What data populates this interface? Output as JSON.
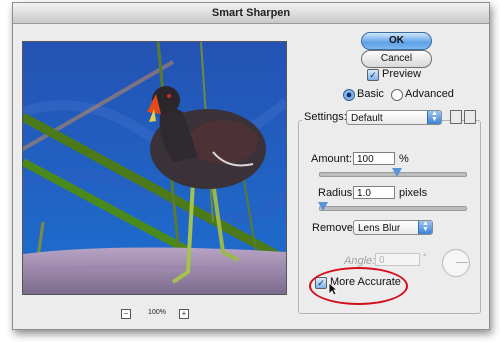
{
  "window": {
    "title": "Smart Sharpen"
  },
  "preview": {
    "zoom_label": "100%",
    "zoom_out": "−",
    "zoom_in": "+"
  },
  "buttons": {
    "ok": "OK",
    "cancel": "Cancel"
  },
  "preview_toggle": {
    "label": "Preview",
    "checked": true
  },
  "mode": {
    "basic_label": "Basic",
    "advanced_label": "Advanced",
    "selected": "Basic"
  },
  "settings": {
    "label": "Settings:",
    "value": "Default"
  },
  "amount": {
    "label": "Amount:",
    "value": "100",
    "unit": "%"
  },
  "radius": {
    "label": "Radius:",
    "value": "1.0",
    "unit": "pixels"
  },
  "remove": {
    "label": "Remove:",
    "value": "Lens Blur"
  },
  "angle": {
    "label": "Angle:",
    "value": "0",
    "unit": "°"
  },
  "more_accurate": {
    "label": "More Accurate",
    "checked": true
  },
  "colors": {
    "accent": "#5ea1e6",
    "annotation": "#d40d1a"
  }
}
